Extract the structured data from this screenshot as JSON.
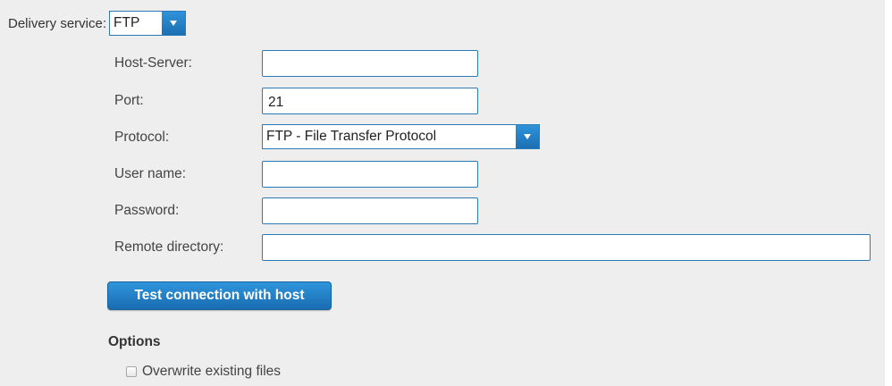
{
  "delivery": {
    "label": "Delivery service:",
    "selected": "FTP"
  },
  "fields": {
    "host": {
      "label": "Host-Server:",
      "value": ""
    },
    "port": {
      "label": "Port:",
      "value": "21"
    },
    "protocol": {
      "label": "Protocol:",
      "selected": "FTP - File Transfer Protocol"
    },
    "username": {
      "label": "User name:",
      "value": ""
    },
    "password": {
      "label": "Password:",
      "value": ""
    },
    "remote_dir": {
      "label": "Remote directory:",
      "value": ""
    }
  },
  "test_button": {
    "label": "Test connection with host"
  },
  "options": {
    "heading": "Options",
    "overwrite": {
      "label": "Overwrite existing files",
      "checked": false
    }
  },
  "icons": {
    "dropdown": "chevron-down-icon"
  },
  "colors": {
    "accent": "#1f78c1",
    "panel_bg": "#eeeeee",
    "input_border": "#2a7ab8"
  }
}
